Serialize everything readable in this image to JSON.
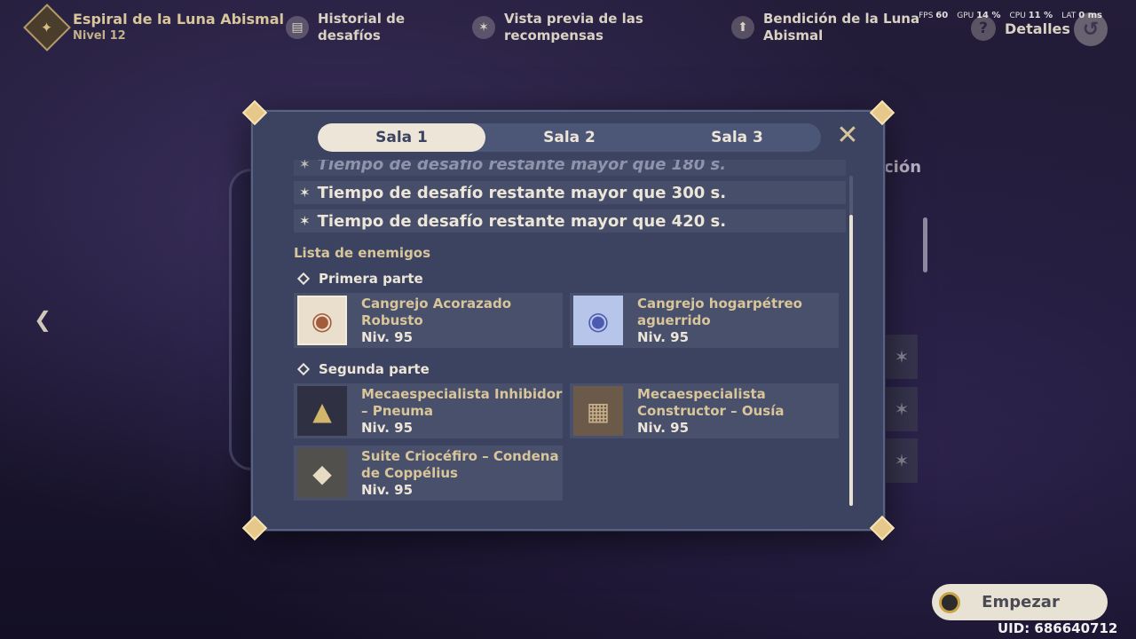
{
  "topbar": {
    "title": "Espiral de la Luna Abismal",
    "subtitle": "Nivel 12",
    "history": "Historial de\ndesafíos",
    "rewards": "Vista previa de las\nrecompensas",
    "blessing": "Bendición de la Luna\nAbismal",
    "details": "Detalles",
    "perf": {
      "fps_label": "FPS",
      "fps": "60",
      "gpu_label": "GPU",
      "gpu": "14 %",
      "cpu_label": "CPU",
      "cpu": "11 %",
      "lat_label": "LAT",
      "lat": "0 ms"
    }
  },
  "background": {
    "right_text": "ción"
  },
  "modal": {
    "tabs": [
      "Sala 1",
      "Sala 2",
      "Sala 3"
    ],
    "active_tab": 0,
    "conditions": [
      "Tiempo de desafío restante mayor que 180 s.",
      "Tiempo de desafío restante mayor que 300 s.",
      "Tiempo de desafío restante mayor que 420 s."
    ],
    "enemy_list_title": "Lista de enemigos",
    "parts": [
      {
        "title": "Primera parte",
        "enemies": [
          {
            "name": "Cangrejo Acorazado Robusto",
            "level": "Niv. 95",
            "icon": "crab-icon"
          },
          {
            "name": "Cangrejo hogarpétreo aguerrido",
            "level": "Niv. 95",
            "icon": "crab-icon"
          }
        ]
      },
      {
        "title": "Segunda parte",
        "enemies": [
          {
            "name": "Mecaespecialista Inhibidor – Pneuma",
            "level": "Niv. 95",
            "icon": "mech-icon"
          },
          {
            "name": "Mecaespecialista Constructor – Ousía",
            "level": "Niv. 95",
            "icon": "mech-icon"
          },
          {
            "name": "Suite Criocéfiro – Condena de Coppélius",
            "level": "Niv. 95",
            "icon": "mech-icon"
          }
        ]
      }
    ]
  },
  "start_button": "Empezar",
  "uid": "UID: 686640712"
}
